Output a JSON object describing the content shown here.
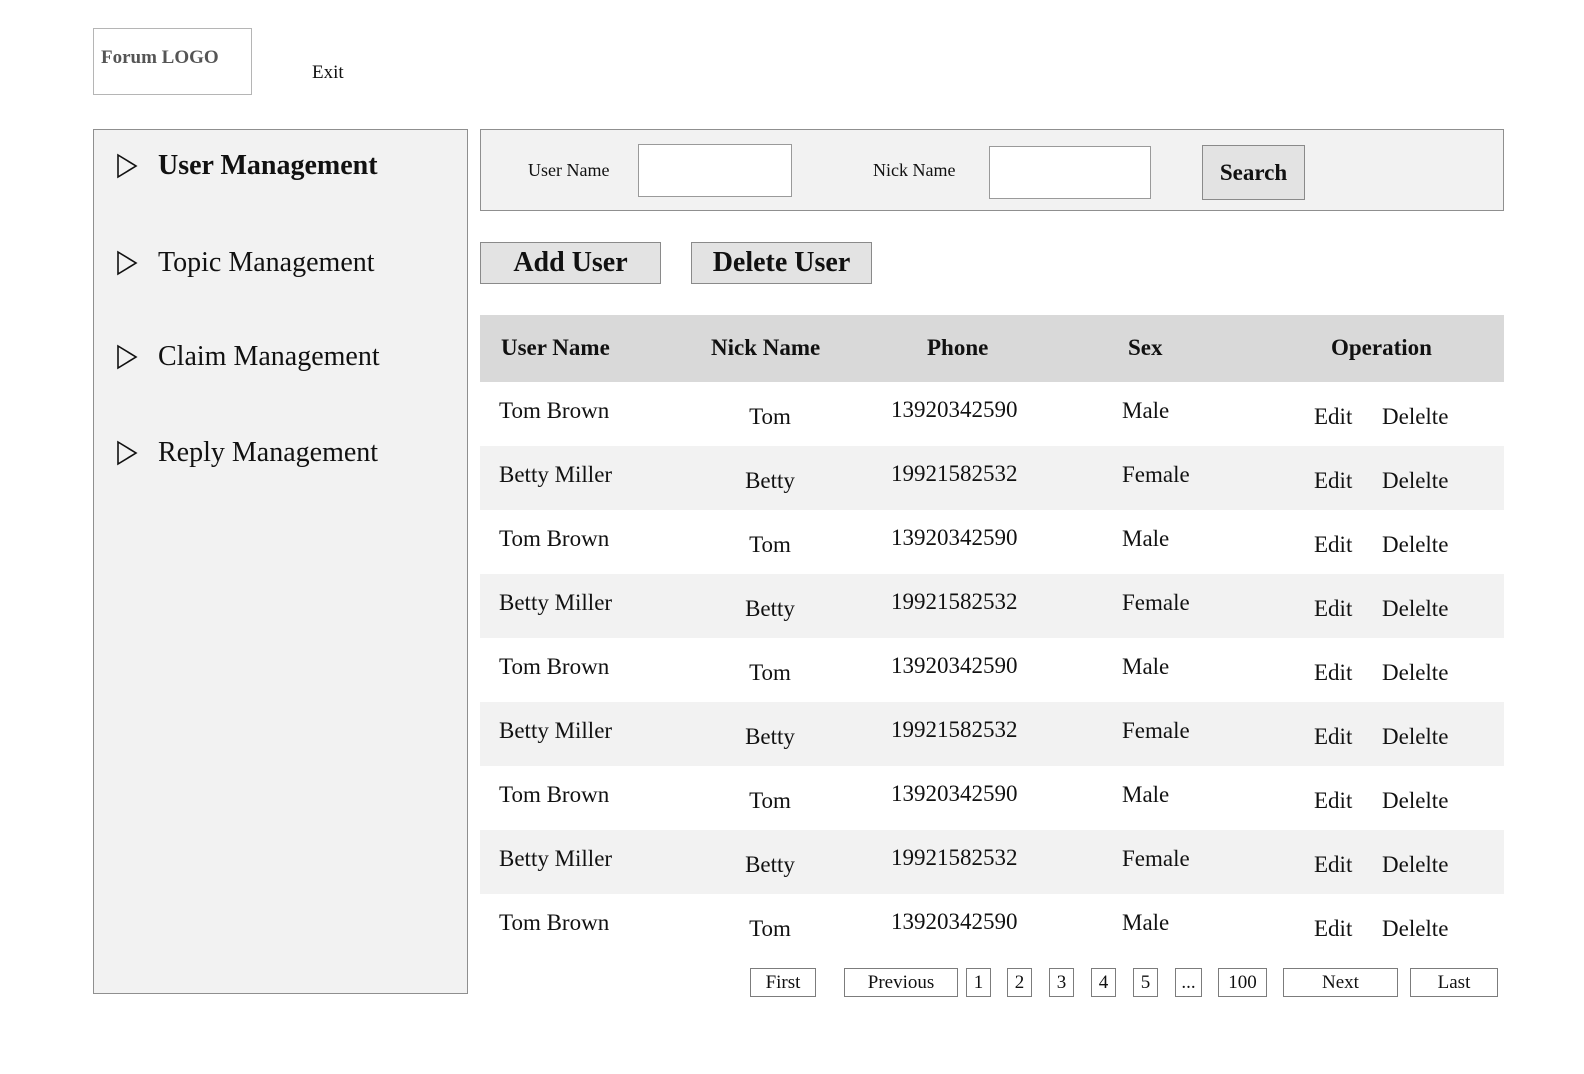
{
  "header": {
    "logo_text": "Forum LOGO",
    "exit_label": "Exit"
  },
  "sidebar": {
    "items": [
      {
        "label": "User Management",
        "icon": "triangle-right-outline-icon",
        "active": true
      },
      {
        "label": "Topic Management",
        "icon": "triangle-right-outline-icon",
        "active": false
      },
      {
        "label": "Claim Management",
        "icon": "triangle-right-outline-icon",
        "active": false
      },
      {
        "label": "Reply Management",
        "icon": "triangle-right-outline-icon",
        "active": false
      }
    ]
  },
  "search": {
    "user_name_label": "User Name",
    "user_name_value": "",
    "nick_name_label": "Nick Name",
    "nick_name_value": "",
    "search_label": "Search"
  },
  "actions": {
    "add_user": "Add User",
    "delete_user": "Delete User"
  },
  "table": {
    "columns": [
      "User Name",
      "Nick Name",
      "Phone",
      "Sex",
      "Operation"
    ],
    "rows": [
      {
        "user_name": "Tom Brown",
        "nick_name": "Tom",
        "phone": "13920342590",
        "sex": "Male",
        "edit": "Edit",
        "delete": "Delelte"
      },
      {
        "user_name": "Betty Miller",
        "nick_name": "Betty",
        "phone": "19921582532",
        "sex": "Female",
        "edit": "Edit",
        "delete": "Delelte"
      },
      {
        "user_name": "Tom Brown",
        "nick_name": "Tom",
        "phone": "13920342590",
        "sex": "Male",
        "edit": "Edit",
        "delete": "Delelte"
      },
      {
        "user_name": "Betty Miller",
        "nick_name": "Betty",
        "phone": "19921582532",
        "sex": "Female",
        "edit": "Edit",
        "delete": "Delelte"
      },
      {
        "user_name": "Tom Brown",
        "nick_name": "Tom",
        "phone": "13920342590",
        "sex": "Male",
        "edit": "Edit",
        "delete": "Delelte"
      },
      {
        "user_name": "Betty Miller",
        "nick_name": "Betty",
        "phone": "19921582532",
        "sex": "Female",
        "edit": "Edit",
        "delete": "Delelte"
      },
      {
        "user_name": "Tom Brown",
        "nick_name": "Tom",
        "phone": "13920342590",
        "sex": "Male",
        "edit": "Edit",
        "delete": "Delelte"
      },
      {
        "user_name": "Betty Miller",
        "nick_name": "Betty",
        "phone": "19921582532",
        "sex": "Female",
        "edit": "Edit",
        "delete": "Delelte"
      },
      {
        "user_name": "Tom Brown",
        "nick_name": "Tom",
        "phone": "13920342590",
        "sex": "Male",
        "edit": "Edit",
        "delete": "Delelte"
      }
    ]
  },
  "pagination": {
    "first": "First",
    "previous": "Previous",
    "pages": [
      "1",
      "2",
      "3",
      "4",
      "5",
      "...",
      "100"
    ],
    "next": "Next",
    "last": "Last"
  },
  "colors": {
    "panel_bg": "#f2f2f2",
    "header_bg": "#d9d9d9",
    "button_bg": "#e3e3e3",
    "border": "#8f8f8f"
  }
}
